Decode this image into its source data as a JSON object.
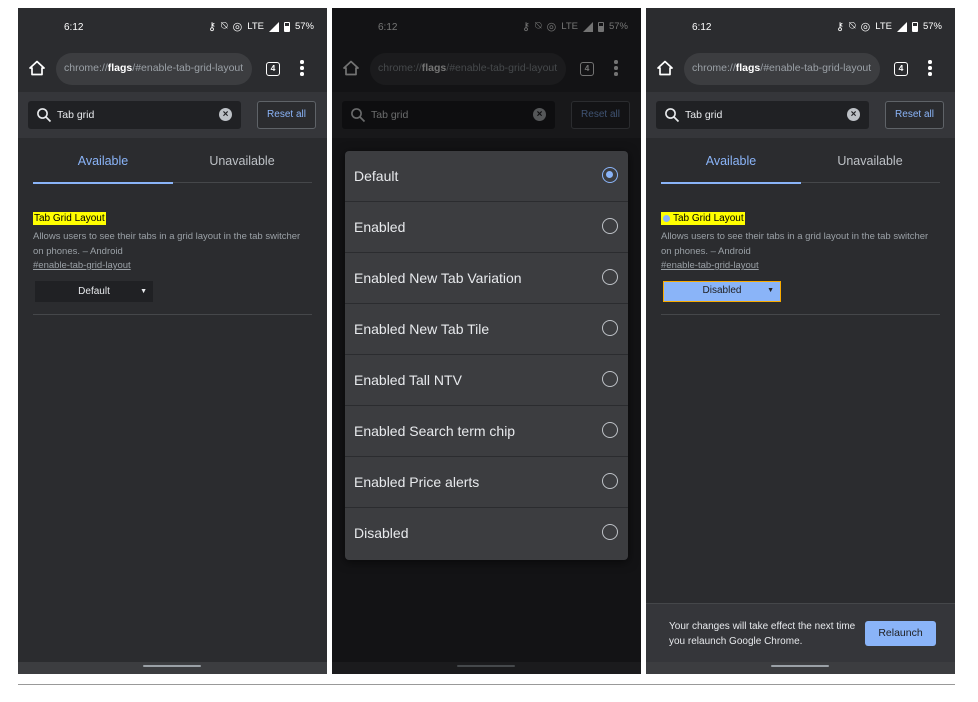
{
  "status": {
    "time": "6:12",
    "network": "LTE",
    "battery": "57%"
  },
  "toolbar": {
    "url_prefix": "chrome://",
    "url_bold": "flags",
    "url_suffix": "/#enable-tab-grid-layout",
    "tab_count": "4"
  },
  "search": {
    "query": "Tab grid",
    "reset_label": "Reset all"
  },
  "tabs": {
    "available": "Available",
    "unavailable": "Unavailable"
  },
  "flag": {
    "title": "Tab Grid Layout",
    "description": "Allows users to see their tabs in a grid layout in the tab switcher on phones. – Android",
    "link": "#enable-tab-grid-layout",
    "selected_default": "Default",
    "selected_disabled": "Disabled"
  },
  "dropdown": {
    "options": [
      {
        "label": "Default",
        "selected": true
      },
      {
        "label": "Enabled",
        "selected": false
      },
      {
        "label": "Enabled New Tab Variation",
        "selected": false
      },
      {
        "label": "Enabled New Tab Tile",
        "selected": false
      },
      {
        "label": "Enabled Tall NTV",
        "selected": false
      },
      {
        "label": "Enabled Search term chip",
        "selected": false
      },
      {
        "label": "Enabled Price alerts",
        "selected": false
      },
      {
        "label": "Disabled",
        "selected": false
      }
    ]
  },
  "relaunch": {
    "message": "Your changes will take effect the next time you relaunch Google Chrome.",
    "button": "Relaunch"
  },
  "colors": {
    "accent": "#8ab4f8",
    "highlight": "#ffff00",
    "background": "#2b2c2f"
  }
}
